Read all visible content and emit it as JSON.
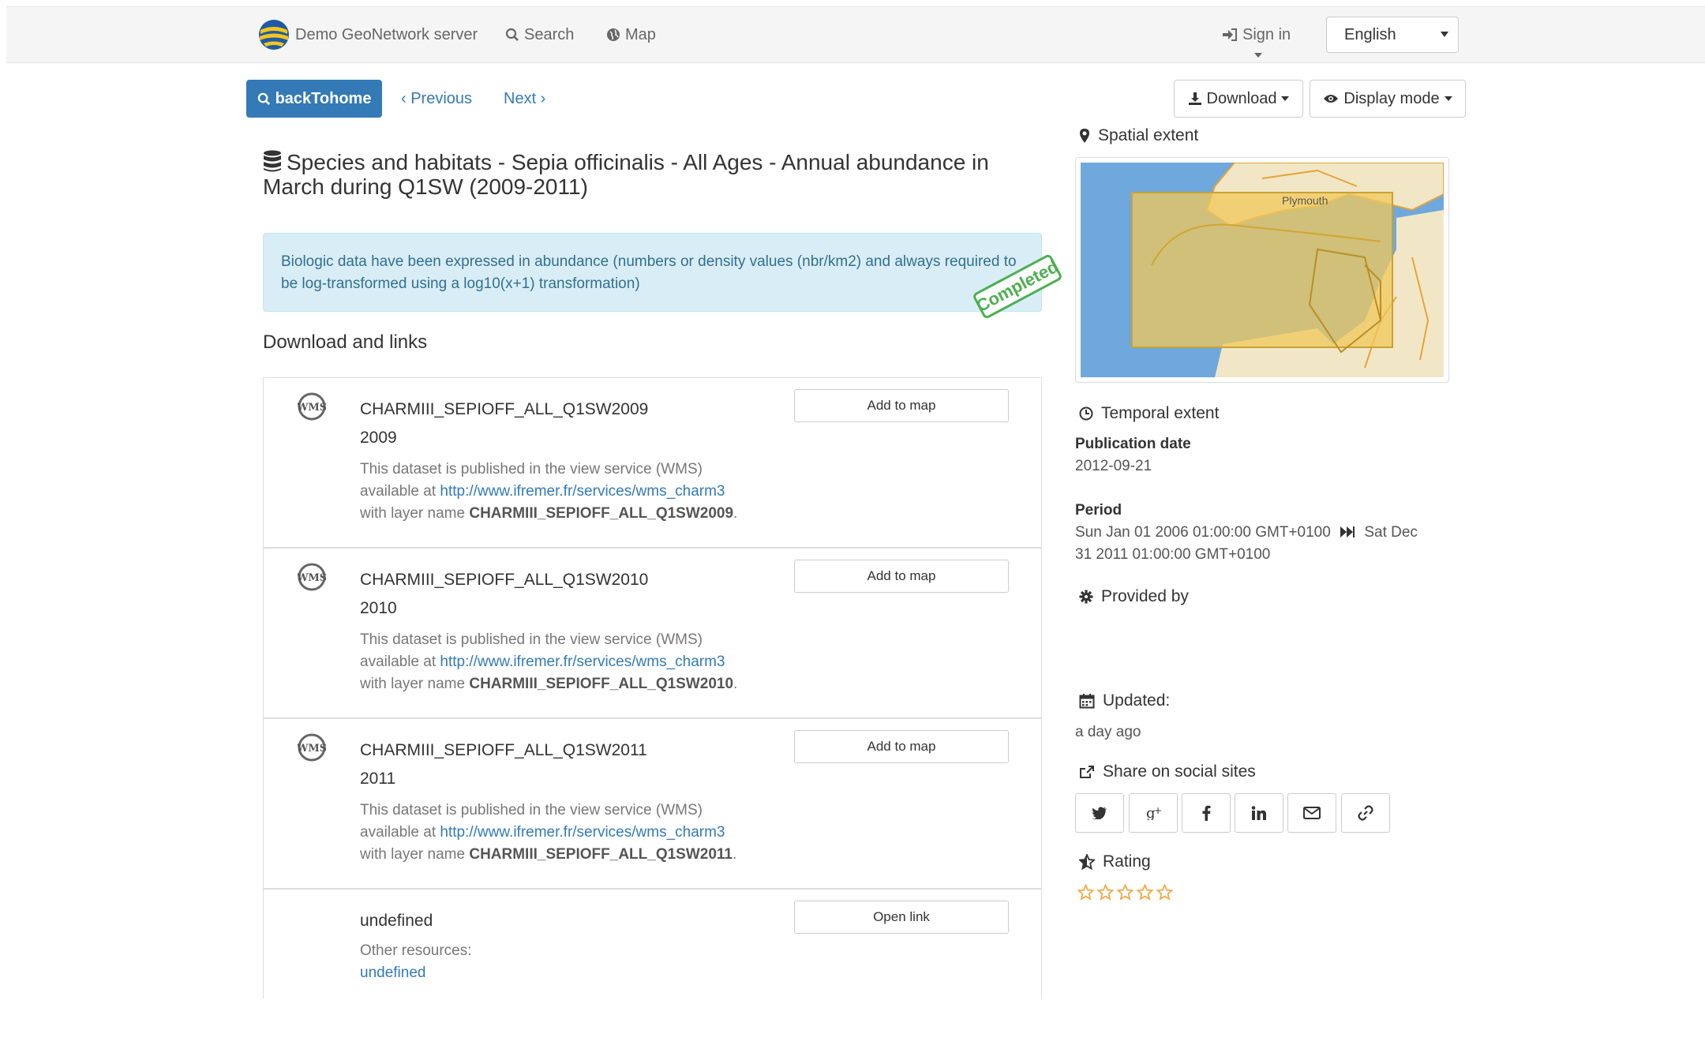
{
  "navbar": {
    "brand": "Demo GeoNetwork server",
    "search": "Search",
    "map": "Map",
    "sign_in": "Sign in",
    "language": "English"
  },
  "toolbar": {
    "back": "backTohome",
    "previous": "‹ Previous",
    "next": "Next ›",
    "download": "Download",
    "display_mode": "Display mode"
  },
  "record": {
    "title": "Species and habitats - Sepia officinalis - All Ages - Annual abundance in March during Q1SW (2009-2011)",
    "abstract": "Biologic data have been expressed in abundance (numbers or density values (nbr/km2) and always required to be log-transformed using a log10(x+1) transformation)",
    "status": "Completed",
    "links_heading": "Download and links"
  },
  "links": [
    {
      "name": "CHARMIII_SEPIOFF_ALL_Q1SW2009",
      "year": "2009",
      "line1": "This dataset is published in the view service (WMS)",
      "line2_prefix": "available at ",
      "url": "http://www.ifremer.fr/services/wms_charm3",
      "line3_prefix": "with layer name ",
      "layer": "CHARMIII_SEPIOFF_ALL_Q1SW2009",
      "line3_suffix": ".",
      "action": "Add to map"
    },
    {
      "name": "CHARMIII_SEPIOFF_ALL_Q1SW2010",
      "year": "2010",
      "line1": "This dataset is published in the view service (WMS)",
      "line2_prefix": "available at ",
      "url": "http://www.ifremer.fr/services/wms_charm3",
      "line3_prefix": "with layer name ",
      "layer": "CHARMIII_SEPIOFF_ALL_Q1SW2010",
      "line3_suffix": ".",
      "action": "Add to map"
    },
    {
      "name": "CHARMIII_SEPIOFF_ALL_Q1SW2011",
      "year": "2011",
      "line1": "This dataset is published in the view service (WMS)",
      "line2_prefix": "available at ",
      "url": "http://www.ifremer.fr/services/wms_charm3",
      "line3_prefix": "with layer name ",
      "layer": "CHARMIII_SEPIOFF_ALL_Q1SW2011",
      "line3_suffix": ".",
      "action": "Add to map"
    }
  ],
  "other_link": {
    "name": "undefined",
    "label": "Other resources:",
    "value": "undefined",
    "action": "Open link"
  },
  "sidebar": {
    "spatial_extent": "Spatial extent",
    "map_label": "Plymouth",
    "temporal_extent": "Temporal extent",
    "publication_date_label": "Publication date",
    "publication_date": "2012-09-21",
    "period_label": "Period",
    "period_start": "Sun Jan 01 2006 01:00:00 GMT+0100",
    "period_end_part1": "Sat Dec",
    "period_end_part2": "31 2011 01:00:00 GMT+0100",
    "provided_by": "Provided by",
    "updated_label": "Updated:",
    "updated_value": "a day ago",
    "share": "Share on social sites",
    "rating": "Rating",
    "rating_value": 0,
    "rating_max": 5
  },
  "social_icons": [
    "twitter-icon",
    "google-plus-icon",
    "facebook-icon",
    "linkedin-icon",
    "email-icon",
    "link-icon"
  ],
  "colors": {
    "primary": "#337ab7",
    "alert_bg": "#d9edf7",
    "alert_text": "#31708f",
    "stamp": "#4caf50",
    "star": "#f0ad4e"
  }
}
